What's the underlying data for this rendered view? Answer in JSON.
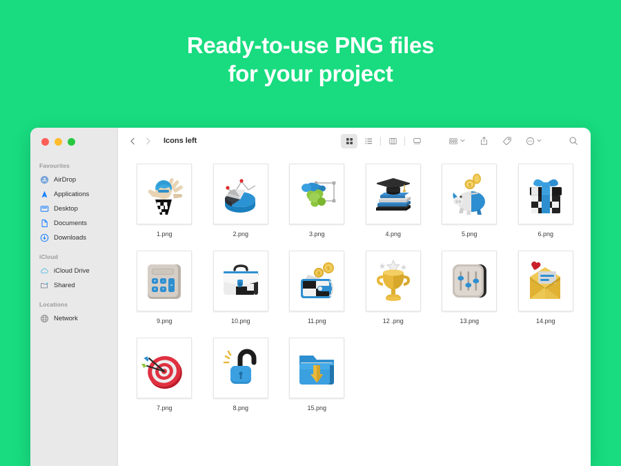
{
  "hero": {
    "line1": "Ready-to-use PNG files",
    "line2": "for your project"
  },
  "colors": {
    "background_green": "#18dc7f",
    "sidebar_gray": "#e9e9e9",
    "accent_blue": "#0a7aff",
    "traffic_red": "#ff5f57",
    "traffic_yellow": "#febc2e",
    "traffic_green": "#28c840"
  },
  "window": {
    "traffic_lights": [
      "close",
      "minimize",
      "maximize"
    ],
    "toolbar": {
      "back_label": "‹",
      "forward_label": "›",
      "breadcrumb": "Icons left",
      "view_buttons": [
        {
          "name": "icon-view",
          "active": true
        },
        {
          "name": "list-view",
          "active": false
        },
        {
          "name": "column-view",
          "active": false
        },
        {
          "name": "gallery-view",
          "active": false
        }
      ],
      "actions": [
        "group-by",
        "share",
        "tag",
        "more",
        "search"
      ]
    },
    "sidebar": {
      "sections": [
        {
          "title": "Favourites",
          "items": [
            {
              "label": "AirDrop",
              "icon": "airdrop-icon"
            },
            {
              "label": "Applications",
              "icon": "applications-icon"
            },
            {
              "label": "Desktop",
              "icon": "desktop-icon"
            },
            {
              "label": "Documents",
              "icon": "documents-icon"
            },
            {
              "label": "Downloads",
              "icon": "downloads-icon"
            }
          ]
        },
        {
          "title": "iCloud",
          "items": [
            {
              "label": "iCloud Drive",
              "icon": "icloud-drive-icon"
            },
            {
              "label": "Shared",
              "icon": "shared-folder-icon"
            }
          ]
        },
        {
          "title": "Locations",
          "items": [
            {
              "label": "Network",
              "icon": "network-icon"
            }
          ]
        }
      ]
    },
    "files": [
      {
        "name": "1.png",
        "icon": "waving-person-icon"
      },
      {
        "name": "2.png",
        "icon": "pie-chart-icon"
      },
      {
        "name": "3.png",
        "icon": "abstract-shape-icon"
      },
      {
        "name": "4.png",
        "icon": "graduation-cap-books-icon"
      },
      {
        "name": "5.png",
        "icon": "piggy-bank-icon"
      },
      {
        "name": "6.png",
        "icon": "gift-box-icon"
      },
      {
        "name": "9.png",
        "icon": "calculator-icon"
      },
      {
        "name": "10.png",
        "icon": "briefcase-icon"
      },
      {
        "name": "11.png",
        "icon": "wallet-coins-icon"
      },
      {
        "name": "12 .png",
        "icon": "trophy-icon"
      },
      {
        "name": "13.png",
        "icon": "sliders-icon"
      },
      {
        "name": "14.png",
        "icon": "envelope-heart-icon"
      },
      {
        "name": "7.png",
        "icon": "dartboard-arrows-icon"
      },
      {
        "name": "8.png",
        "icon": "open-padlock-icon"
      },
      {
        "name": "15.png",
        "icon": "download-folder-icon"
      }
    ]
  }
}
